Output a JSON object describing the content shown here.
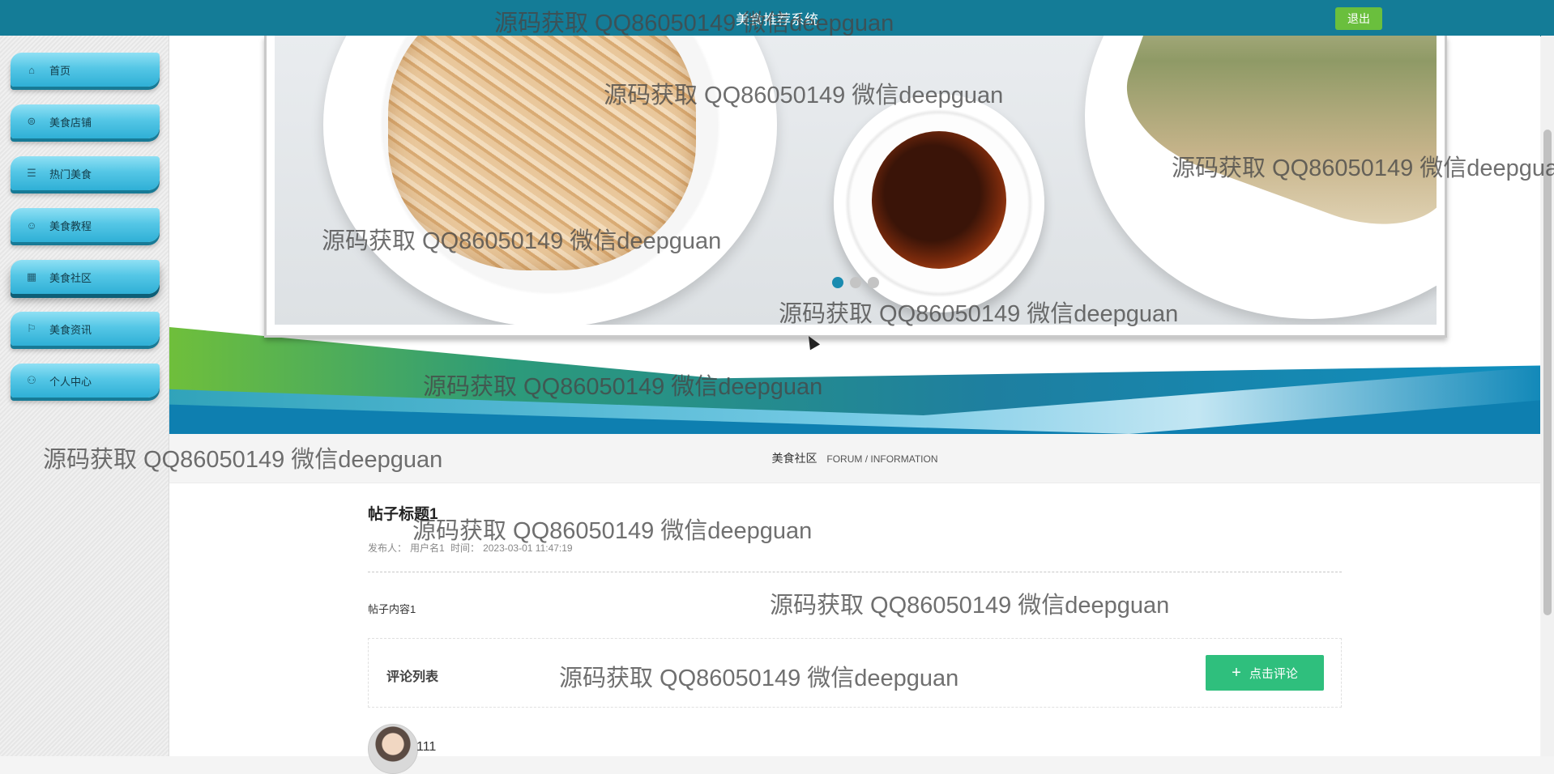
{
  "header": {
    "title": "美食推荐系统",
    "logout_label": "退出"
  },
  "sidebar": {
    "items": [
      {
        "label": "首页",
        "icon": "home-icon",
        "glyph": "⌂"
      },
      {
        "label": "美食店铺",
        "icon": "shop-icon",
        "glyph": "⊜"
      },
      {
        "label": "热门美食",
        "icon": "sliders-icon",
        "glyph": "☰"
      },
      {
        "label": "美食教程",
        "icon": "smile-icon",
        "glyph": "☺"
      },
      {
        "label": "美食社区",
        "icon": "grid-icon",
        "glyph": "▦"
      },
      {
        "label": "美食资讯",
        "icon": "flag-icon",
        "glyph": "⚐"
      },
      {
        "label": "个人中心",
        "icon": "user-icon",
        "glyph": "⚇"
      }
    ],
    "active_index": 4
  },
  "banner": {
    "slide_count": 3,
    "active_slide": 1
  },
  "section": {
    "title": "美食社区",
    "subtitle": "FORUM / INFORMATION"
  },
  "post": {
    "title": "帖子标题1",
    "author_label": "发布人：",
    "author": "用户名1",
    "time_label": "时间：",
    "time": "2023-03-01 11:47:19",
    "content": "帖子内容1"
  },
  "comments": {
    "heading": "评论列表",
    "add_label": "点击评论",
    "first_commenter": "111"
  },
  "watermark": "源码获取 QQ86050149 微信deepguan",
  "colors": {
    "header": "#147c97",
    "logout": "#6abf3d",
    "comment_button": "#2fbf7d",
    "active_dot": "#1a8bb0"
  }
}
